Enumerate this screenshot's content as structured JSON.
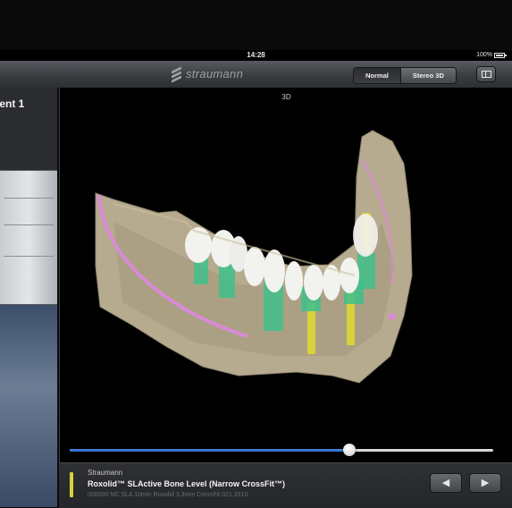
{
  "status": {
    "time": "14:28",
    "battery": "100%"
  },
  "toolbar": {
    "brand": "straumann",
    "view_modes": [
      "Normal",
      "Stereo 3D"
    ],
    "active_mode": "Normal"
  },
  "left": {
    "patient_title": "ient 1"
  },
  "viewer": {
    "label": "3D"
  },
  "slider": {
    "position": 0.66
  },
  "implant": {
    "brand": "Straumann",
    "product": "Roxolid™ SLActive Bone Level (Narrow CrossFit™)",
    "detail": "000000 NC SLA 10mm Roxolid 3.3mm CrossFit 021.3310",
    "color": "#d9d23b"
  },
  "nav": {
    "prev": "◀",
    "next": "▶"
  },
  "colors": {
    "bone": "#b7ab8f",
    "tooth": "#f2f2ee",
    "abutment": "#3fbf8a",
    "implant": "#d9d23b",
    "nerve": "#d98ad6",
    "accent": "#2a63c2"
  }
}
